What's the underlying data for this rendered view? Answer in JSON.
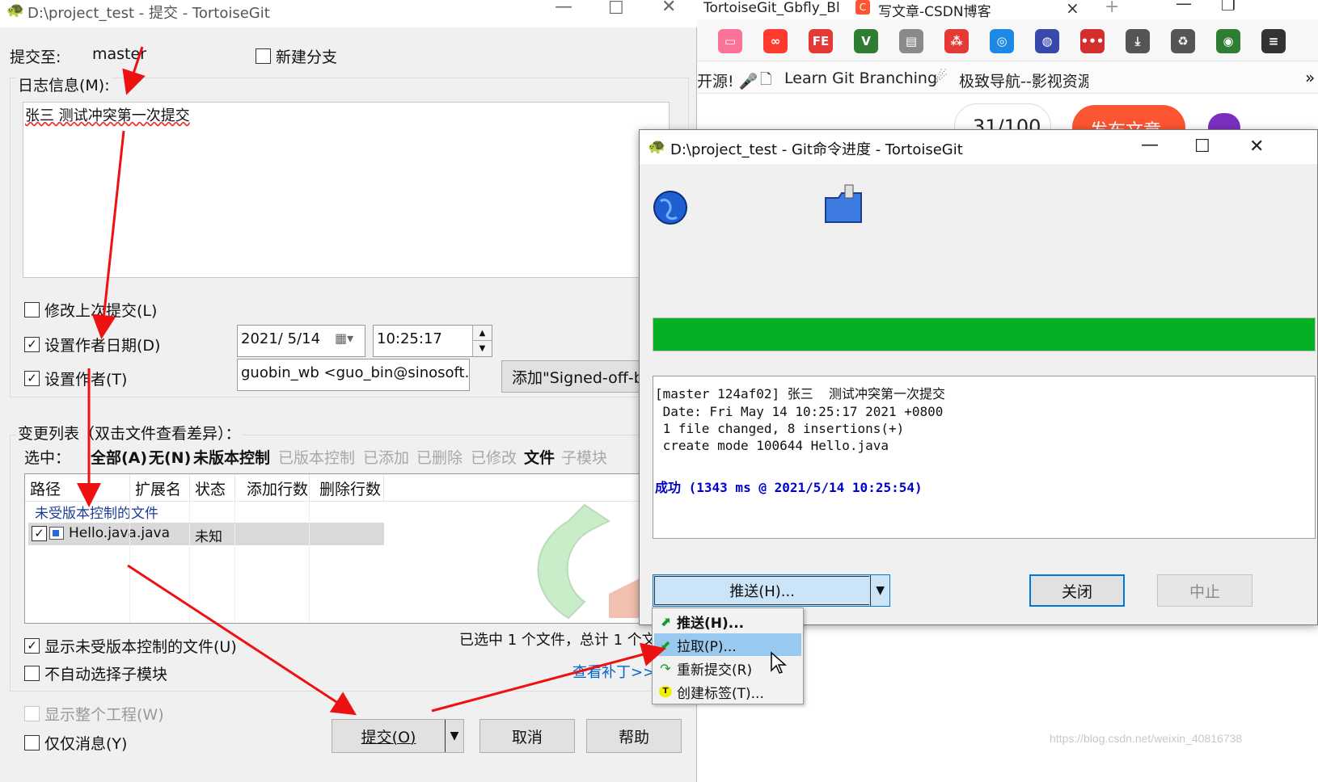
{
  "browser": {
    "tabs": [
      "TortoiseGit_Gbfly_Bl",
      "写文章-CSDN博客"
    ],
    "tab_close": "×",
    "new_tab": "+",
    "window_controls": [
      "—",
      "❐"
    ],
    "toolbar_icons": [
      {
        "name": "bilibili-icon",
        "glyph": "▭",
        "color": "#fb7299"
      },
      {
        "name": "infinity-icon",
        "glyph": "∞",
        "color": "#ff3b30"
      },
      {
        "name": "fe-icon",
        "glyph": "FE",
        "color": "#e53935"
      },
      {
        "name": "vue-icon",
        "glyph": "V",
        "color": "#2e7d32"
      },
      {
        "name": "briefcase-icon",
        "glyph": "▤",
        "color": "#8a8a8a"
      },
      {
        "name": "network-icon",
        "glyph": "⁂",
        "color": "#e53935"
      },
      {
        "name": "chat-icon",
        "glyph": "◎",
        "color": "#1e88e5"
      },
      {
        "name": "search-globe-icon",
        "glyph": "◍",
        "color": "#3949ab"
      },
      {
        "name": "dots-icon",
        "glyph": "•••",
        "color": "#d32f2f"
      },
      {
        "name": "download-icon",
        "glyph": "⤓",
        "color": "#555555"
      },
      {
        "name": "recycle-icon",
        "glyph": "♻",
        "color": "#555555"
      },
      {
        "name": "globe-icon",
        "glyph": "◉",
        "color": "#2e7d32"
      },
      {
        "name": "more-icon",
        "glyph": "≡",
        "color": "#333333"
      }
    ],
    "bookmarks": [
      "开源! 🎤",
      "Learn Git Branching",
      "极致导航--影视资源!"
    ],
    "bookmarks_more": "»",
    "page_counter": "31/100",
    "publish_button": "发布文章"
  },
  "commit_dialog": {
    "title": "D:\\project_test - 提交 - TortoiseGit",
    "commit_to_label": "提交至:",
    "branch": "master",
    "new_branch_label": "新建分支",
    "log_message_label": "日志信息(M):",
    "message": "张三  测试冲突第一次提交",
    "amend_label": "修改上次提交(L)",
    "set_author_date_label": "设置作者日期(D)",
    "date_value": "2021/  5/14",
    "time_value": "10:25:17",
    "set_author_label": "设置作者(T)",
    "author_value": "guobin_wb <guo_bin@sinosoft.com",
    "signed_off_button": "添加\"Signed-off-by\"",
    "changes_label": "变更列表（双击文件查看差异）：",
    "select_label": "选中：",
    "filters_bold": [
      "全部(A)",
      "无(N)",
      "未版本控制"
    ],
    "filters_gray": [
      "已版本控制",
      "已添加",
      "已删除",
      "已修改"
    ],
    "filter_file": "文件",
    "filter_submodule": "子模块",
    "columns": [
      "路径",
      "扩展名",
      "状态",
      "添加行数",
      "删除行数"
    ],
    "group_header": "未受版本控制的文件",
    "files": [
      {
        "path": "Hello.java",
        "ext": ".java",
        "status": "未知",
        "checked": true
      }
    ],
    "show_unversioned_label": "显示未受版本控制的文件(U)",
    "no_auto_submodule_label": "不自动选择子模块",
    "selected_summary": "已选中 1 个文件，总计 1 个文",
    "view_patch_link": "查看补丁>>",
    "show_whole_project_label": "显示整个工程(W)",
    "message_only_label": "仅仅消息(Y)",
    "commit_button": "提交(O)",
    "cancel_button": "取消",
    "help_button": "帮助"
  },
  "progress_dialog": {
    "title": "D:\\project_test - Git命令进度 - TortoiseGit",
    "progress_percent": 100,
    "progress_color": "#06b025",
    "output_lines": [
      "[master 124af02] 张三  测试冲突第一次提交",
      " Date: Fri May 14 10:25:17 2021 +0800",
      " 1 file changed, 8 insertions(+)",
      " create mode 100644 Hello.java"
    ],
    "success_text": "成功 (1343 ms @ 2021/5/14 10:25:54)",
    "success_color": "#0000cc",
    "push_button": "推送(H)...",
    "close_button": "关闭",
    "abort_button": "中止"
  },
  "menu": {
    "items": [
      {
        "label": "推送(H)...",
        "icon": "push-arrow-icon",
        "bold": true
      },
      {
        "label": "拉取(P)...",
        "icon": "pull-arrow-icon",
        "bold": false,
        "highlight": true
      },
      {
        "label": "重新提交(R)",
        "icon": "recommit-arrow-icon",
        "bold": false
      },
      {
        "label": "创建标签(T)...",
        "icon": "tag-icon",
        "bold": false
      }
    ]
  },
  "watermark": "https://blog.csdn.net/weixin_40816738",
  "annotation_color": "#ee1111"
}
